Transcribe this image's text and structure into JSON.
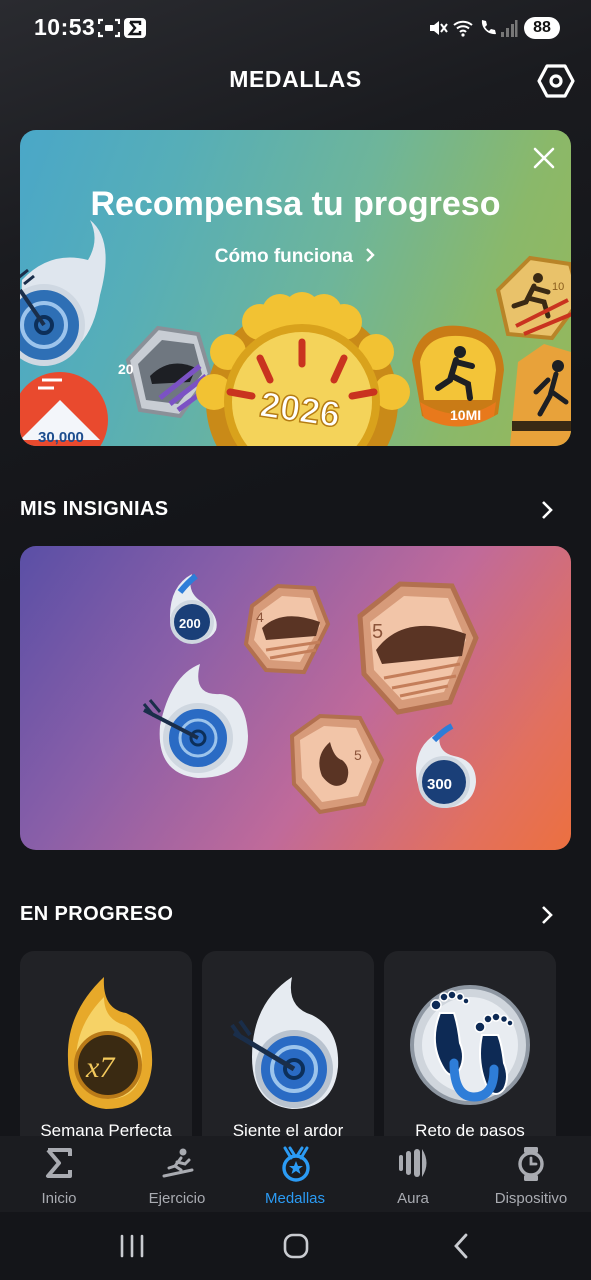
{
  "status_bar": {
    "time": "10:53",
    "battery": "88"
  },
  "header": {
    "title": "MEDALLAS"
  },
  "promo": {
    "title": "Recompensa tu progreso",
    "link": "Cómo funciona",
    "medal_texts": [
      "20",
      "2026",
      "10MI",
      "30,000",
      "10"
    ]
  },
  "insignias": {
    "title": "MIS INSIGNIAS",
    "badges": [
      "200",
      "4",
      "5",
      "5",
      "300"
    ]
  },
  "progress": {
    "title": "EN PROGRESO",
    "cards": [
      {
        "label": "Semana Perfecta",
        "badge_text": "x7"
      },
      {
        "label": "Siente el ardor"
      },
      {
        "label": "Reto de pasos"
      }
    ]
  },
  "nav": {
    "items": [
      {
        "label": "Inicio"
      },
      {
        "label": "Ejercicio"
      },
      {
        "label": "Medallas"
      },
      {
        "label": "Aura"
      },
      {
        "label": "Dispositivo"
      }
    ]
  },
  "colors": {
    "accent": "#2b9bf4",
    "background": "#141519",
    "card": "#212226"
  }
}
